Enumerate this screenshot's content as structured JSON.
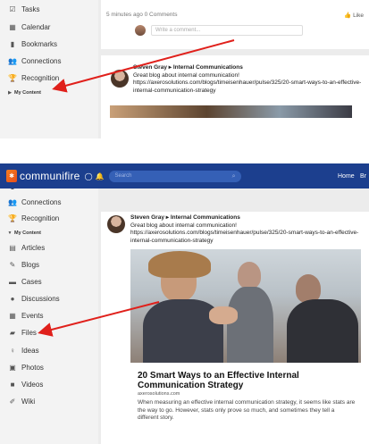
{
  "top": {
    "sidebar": [
      {
        "icon": "checkbox-icon",
        "glyph": "☑",
        "label": "Tasks"
      },
      {
        "icon": "calendar-icon",
        "glyph": "▦",
        "label": "Calendar"
      },
      {
        "icon": "bookmark-icon",
        "glyph": "▮",
        "label": "Bookmarks"
      },
      {
        "icon": "people-icon",
        "glyph": "👥",
        "label": "Connections"
      },
      {
        "icon": "trophy-icon",
        "glyph": "🏆",
        "label": "Recognition"
      },
      {
        "icon": "caret-right-icon",
        "glyph": "▶",
        "label": "My Content"
      }
    ],
    "feed": {
      "meta": "5 minutes ago   0 Comments",
      "like": "Like",
      "comment_placeholder": "Write a comment...",
      "author": "Steven Gray",
      "group": "Internal Communications",
      "text": "Great blog about internal communication!",
      "url": "https://axerosolutions.com/blogs/timeisenhauer/pulse/325/20-smart-ways-to-an-effective-internal-communication-strategy"
    }
  },
  "navbar": {
    "logo": "communifire",
    "logo_mark": "✱",
    "search_placeholder": "Search",
    "home": "Home",
    "truncated": "Br"
  },
  "bottom": {
    "sidebar": [
      {
        "icon": "bookmark-icon",
        "glyph": "▮",
        "label": "Bookmarks"
      },
      {
        "icon": "people-icon",
        "glyph": "👥",
        "label": "Connections"
      },
      {
        "icon": "trophy-icon",
        "glyph": "🏆",
        "label": "Recognition"
      },
      {
        "icon": "caret-down-icon",
        "glyph": "▼",
        "label": "My Content"
      },
      {
        "icon": "article-icon",
        "glyph": "▤",
        "label": "Articles"
      },
      {
        "icon": "blog-icon",
        "glyph": "✎",
        "label": "Blogs"
      },
      {
        "icon": "briefcase-icon",
        "glyph": "▬",
        "label": "Cases"
      },
      {
        "icon": "chat-icon",
        "glyph": "●",
        "label": "Discussions"
      },
      {
        "icon": "calendar-icon",
        "glyph": "▦",
        "label": "Events"
      },
      {
        "icon": "folder-icon",
        "glyph": "▰",
        "label": "Files"
      },
      {
        "icon": "lightbulb-icon",
        "glyph": "♀",
        "label": "Ideas"
      },
      {
        "icon": "photo-icon",
        "glyph": "▣",
        "label": "Photos"
      },
      {
        "icon": "video-icon",
        "glyph": "■",
        "label": "Videos"
      },
      {
        "icon": "wiki-icon",
        "glyph": "✐",
        "label": "Wiki"
      }
    ],
    "post": {
      "author": "Steven Gray",
      "group": "Internal Communications",
      "text": "Great blog about internal communication!",
      "url": "https://axerosolutions.com/blogs/timeisenhauer/pulse/325/20-smart-ways-to-an-effective-internal-communication-strategy"
    },
    "article": {
      "title": "20 Smart Ways to an Effective Internal Communication Strategy",
      "domain": "axerosolutions.com",
      "description": "When measuring an effective internal communication strategy, it seems like stats are the way to go. However, stats only prove so much, and sometimes they tell a different story."
    }
  },
  "colors": {
    "navbar": "#1c3f8e",
    "arrow": "#e0201b",
    "sidebar_bg": "#f3f3f3"
  }
}
